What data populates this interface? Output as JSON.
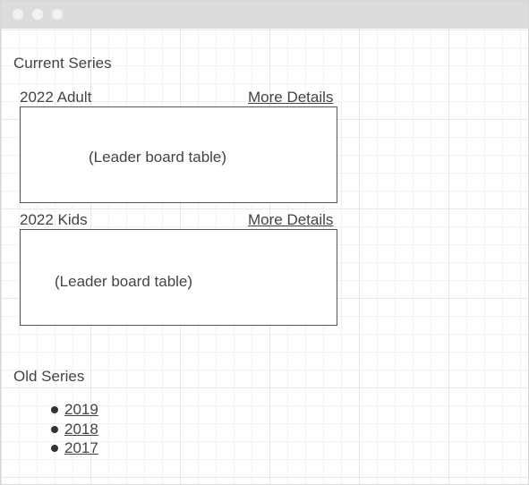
{
  "current_series": {
    "heading": "Current Series",
    "series": [
      {
        "title": "2022 Adult",
        "more_label": "More Details",
        "table_placeholder": "(Leader board table)"
      },
      {
        "title": "2022 Kids",
        "more_label": "More Details",
        "table_placeholder": "(Leader board table)"
      }
    ]
  },
  "old_series": {
    "heading": "Old Series",
    "years": [
      "2019",
      "2018",
      "2017"
    ]
  }
}
